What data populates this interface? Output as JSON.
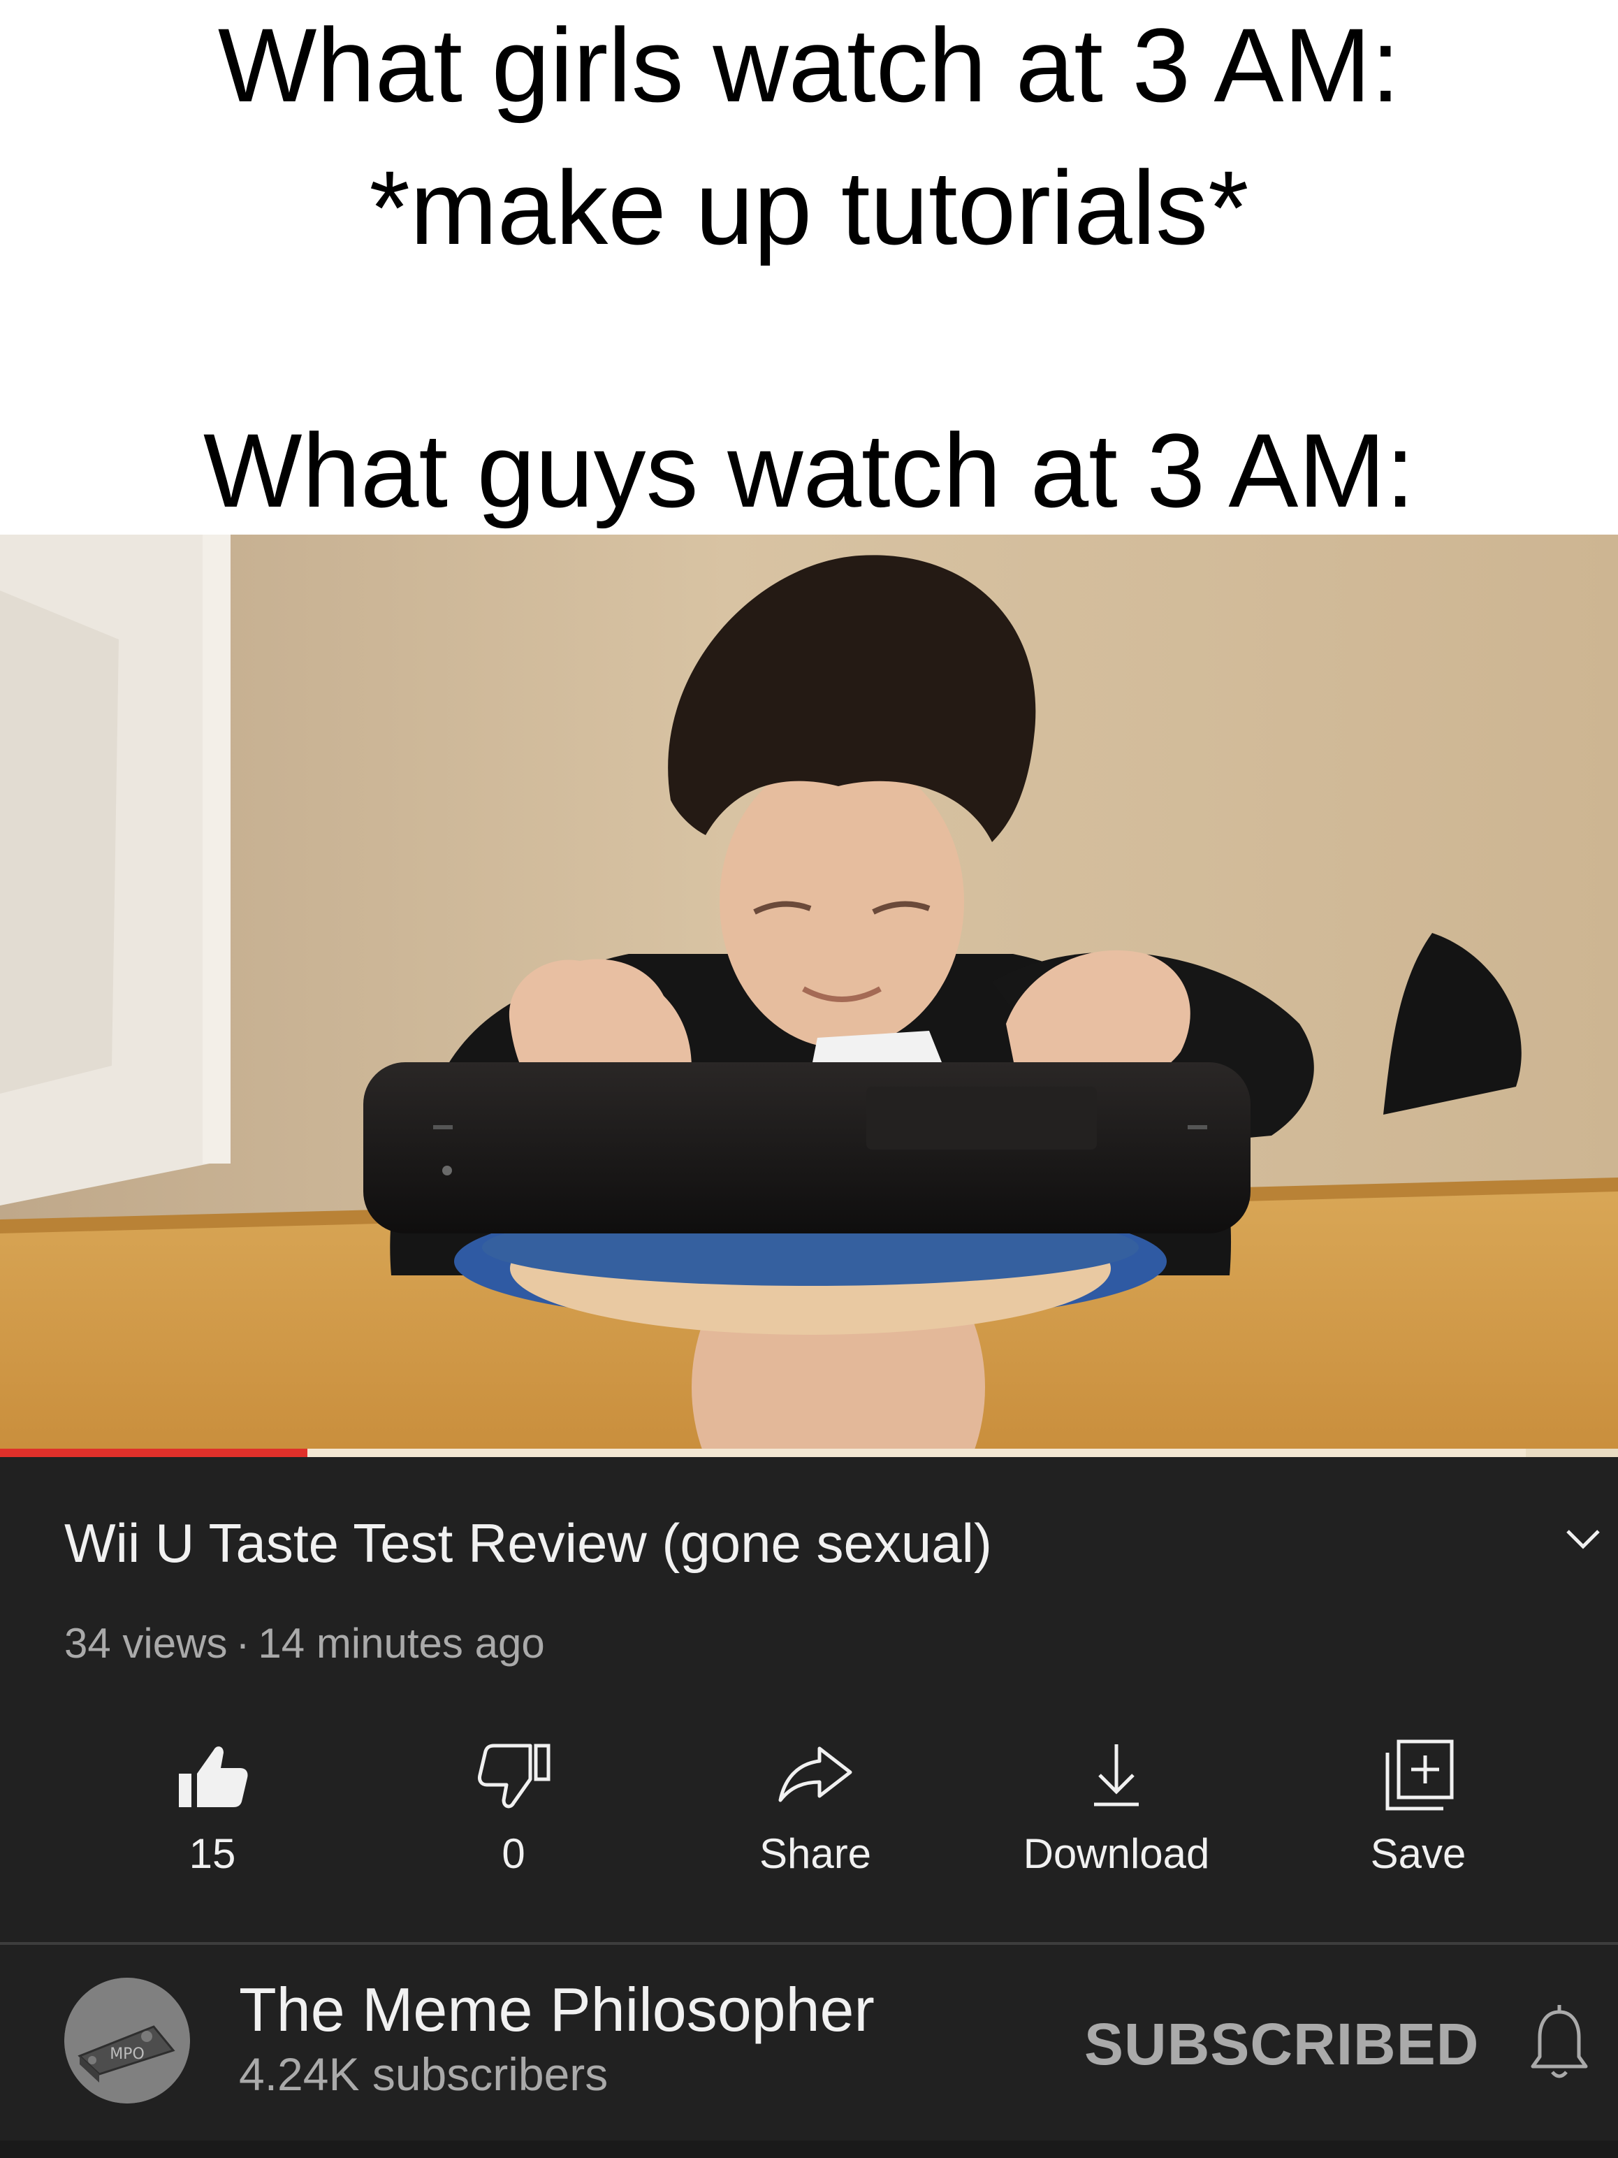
{
  "caption": {
    "line1": "What girls watch at 3 AM:",
    "line2": "*make up tutorials*",
    "line3": "What guys watch at 3 AM:"
  },
  "video": {
    "progress_fraction": 0.19,
    "progress_color": "#e0302a"
  },
  "video_info": {
    "title": "Wii U Taste Test Review (gone sexual)",
    "views": "34 views",
    "separator": "·",
    "uploaded": "14 minutes ago",
    "expand_icon": "chevron-down-icon"
  },
  "actions": {
    "like": {
      "label": "15",
      "icon": "thumbs-up-filled-icon"
    },
    "dislike": {
      "label": "0",
      "icon": "thumbs-down-icon"
    },
    "share": {
      "label": "Share",
      "icon": "share-arrow-icon"
    },
    "download": {
      "label": "Download",
      "icon": "download-icon"
    },
    "save": {
      "label": "Save",
      "icon": "add-to-playlist-icon"
    }
  },
  "channel": {
    "name": "The Meme Philosopher",
    "subscribers": "4.24K subscribers",
    "subscribe_state": "SUBSCRIBED",
    "avatar_text": "MPO",
    "bell_icon": "notification-bell-icon"
  },
  "colors": {
    "panel_bg": "#212121",
    "primary_text": "#f1f1f1",
    "secondary_text": "#aaaaaa"
  }
}
